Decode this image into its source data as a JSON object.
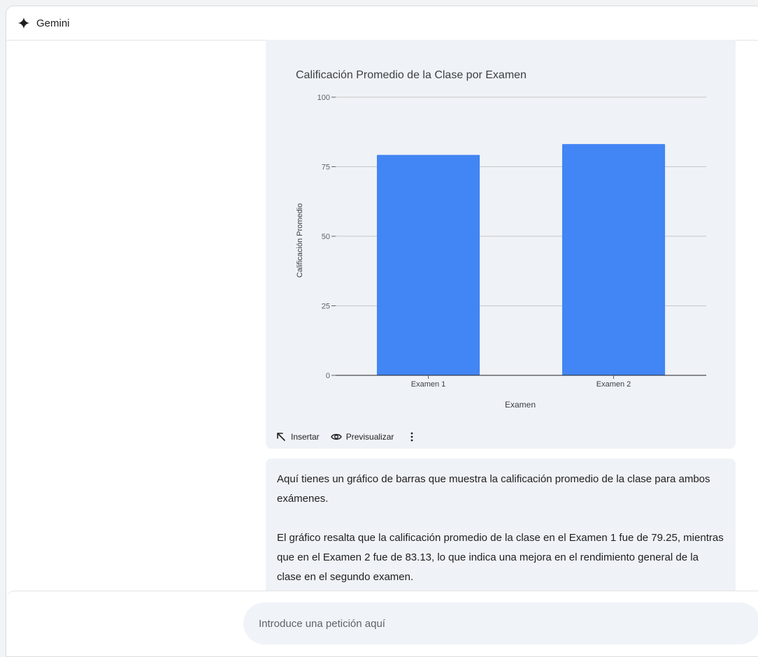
{
  "header": {
    "title": "Gemini",
    "logo_icon": "gemini-sparkle-icon"
  },
  "chart_card": {
    "actions": {
      "insert_label": "Insertar",
      "insert_icon": "arrow-up-left-icon",
      "preview_label": "Previsualizar",
      "preview_icon": "eye-icon",
      "more_icon": "more-vert-icon"
    }
  },
  "chart_data": {
    "type": "bar",
    "title": "Calificación Promedio de la Clase por Examen",
    "xlabel": "Examen",
    "ylabel": "Calificación Promedio",
    "categories": [
      "Examen 1",
      "Examen 2"
    ],
    "values": [
      79.25,
      83.13
    ],
    "ylim": [
      0,
      100
    ],
    "yticks": [
      0,
      25,
      50,
      75,
      100
    ],
    "bar_color": "#4285f4",
    "grid": true
  },
  "message": {
    "paragraph1": "Aquí tienes un gráfico de barras que muestra la calificación promedio de la clase para ambos exámenes.",
    "paragraph2": "El gráfico resalta que la calificación promedio de la clase en el Examen 1 fue de 79.25, mientras que en el Examen 2 fue de 83.13, lo que indica una mejora en el rendimiento general de la clase en el segundo examen."
  },
  "prompt": {
    "placeholder": "Introduce una petición aquí",
    "value": ""
  }
}
